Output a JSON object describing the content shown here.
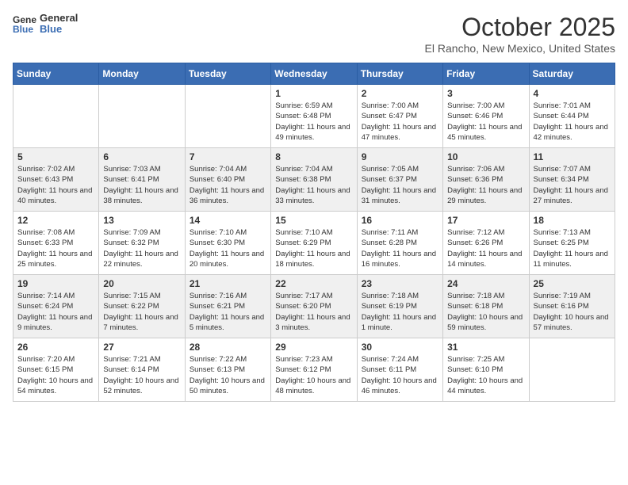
{
  "header": {
    "logo_general": "General",
    "logo_blue": "Blue",
    "month": "October 2025",
    "location": "El Rancho, New Mexico, United States"
  },
  "days_of_week": [
    "Sunday",
    "Monday",
    "Tuesday",
    "Wednesday",
    "Thursday",
    "Friday",
    "Saturday"
  ],
  "weeks": [
    [
      {
        "day": "",
        "info": ""
      },
      {
        "day": "",
        "info": ""
      },
      {
        "day": "",
        "info": ""
      },
      {
        "day": "1",
        "info": "Sunrise: 6:59 AM\nSunset: 6:48 PM\nDaylight: 11 hours and 49 minutes."
      },
      {
        "day": "2",
        "info": "Sunrise: 7:00 AM\nSunset: 6:47 PM\nDaylight: 11 hours and 47 minutes."
      },
      {
        "day": "3",
        "info": "Sunrise: 7:00 AM\nSunset: 6:46 PM\nDaylight: 11 hours and 45 minutes."
      },
      {
        "day": "4",
        "info": "Sunrise: 7:01 AM\nSunset: 6:44 PM\nDaylight: 11 hours and 42 minutes."
      }
    ],
    [
      {
        "day": "5",
        "info": "Sunrise: 7:02 AM\nSunset: 6:43 PM\nDaylight: 11 hours and 40 minutes."
      },
      {
        "day": "6",
        "info": "Sunrise: 7:03 AM\nSunset: 6:41 PM\nDaylight: 11 hours and 38 minutes."
      },
      {
        "day": "7",
        "info": "Sunrise: 7:04 AM\nSunset: 6:40 PM\nDaylight: 11 hours and 36 minutes."
      },
      {
        "day": "8",
        "info": "Sunrise: 7:04 AM\nSunset: 6:38 PM\nDaylight: 11 hours and 33 minutes."
      },
      {
        "day": "9",
        "info": "Sunrise: 7:05 AM\nSunset: 6:37 PM\nDaylight: 11 hours and 31 minutes."
      },
      {
        "day": "10",
        "info": "Sunrise: 7:06 AM\nSunset: 6:36 PM\nDaylight: 11 hours and 29 minutes."
      },
      {
        "day": "11",
        "info": "Sunrise: 7:07 AM\nSunset: 6:34 PM\nDaylight: 11 hours and 27 minutes."
      }
    ],
    [
      {
        "day": "12",
        "info": "Sunrise: 7:08 AM\nSunset: 6:33 PM\nDaylight: 11 hours and 25 minutes."
      },
      {
        "day": "13",
        "info": "Sunrise: 7:09 AM\nSunset: 6:32 PM\nDaylight: 11 hours and 22 minutes."
      },
      {
        "day": "14",
        "info": "Sunrise: 7:10 AM\nSunset: 6:30 PM\nDaylight: 11 hours and 20 minutes."
      },
      {
        "day": "15",
        "info": "Sunrise: 7:10 AM\nSunset: 6:29 PM\nDaylight: 11 hours and 18 minutes."
      },
      {
        "day": "16",
        "info": "Sunrise: 7:11 AM\nSunset: 6:28 PM\nDaylight: 11 hours and 16 minutes."
      },
      {
        "day": "17",
        "info": "Sunrise: 7:12 AM\nSunset: 6:26 PM\nDaylight: 11 hours and 14 minutes."
      },
      {
        "day": "18",
        "info": "Sunrise: 7:13 AM\nSunset: 6:25 PM\nDaylight: 11 hours and 11 minutes."
      }
    ],
    [
      {
        "day": "19",
        "info": "Sunrise: 7:14 AM\nSunset: 6:24 PM\nDaylight: 11 hours and 9 minutes."
      },
      {
        "day": "20",
        "info": "Sunrise: 7:15 AM\nSunset: 6:22 PM\nDaylight: 11 hours and 7 minutes."
      },
      {
        "day": "21",
        "info": "Sunrise: 7:16 AM\nSunset: 6:21 PM\nDaylight: 11 hours and 5 minutes."
      },
      {
        "day": "22",
        "info": "Sunrise: 7:17 AM\nSunset: 6:20 PM\nDaylight: 11 hours and 3 minutes."
      },
      {
        "day": "23",
        "info": "Sunrise: 7:18 AM\nSunset: 6:19 PM\nDaylight: 11 hours and 1 minute."
      },
      {
        "day": "24",
        "info": "Sunrise: 7:18 AM\nSunset: 6:18 PM\nDaylight: 10 hours and 59 minutes."
      },
      {
        "day": "25",
        "info": "Sunrise: 7:19 AM\nSunset: 6:16 PM\nDaylight: 10 hours and 57 minutes."
      }
    ],
    [
      {
        "day": "26",
        "info": "Sunrise: 7:20 AM\nSunset: 6:15 PM\nDaylight: 10 hours and 54 minutes."
      },
      {
        "day": "27",
        "info": "Sunrise: 7:21 AM\nSunset: 6:14 PM\nDaylight: 10 hours and 52 minutes."
      },
      {
        "day": "28",
        "info": "Sunrise: 7:22 AM\nSunset: 6:13 PM\nDaylight: 10 hours and 50 minutes."
      },
      {
        "day": "29",
        "info": "Sunrise: 7:23 AM\nSunset: 6:12 PM\nDaylight: 10 hours and 48 minutes."
      },
      {
        "day": "30",
        "info": "Sunrise: 7:24 AM\nSunset: 6:11 PM\nDaylight: 10 hours and 46 minutes."
      },
      {
        "day": "31",
        "info": "Sunrise: 7:25 AM\nSunset: 6:10 PM\nDaylight: 10 hours and 44 minutes."
      },
      {
        "day": "",
        "info": ""
      }
    ]
  ]
}
